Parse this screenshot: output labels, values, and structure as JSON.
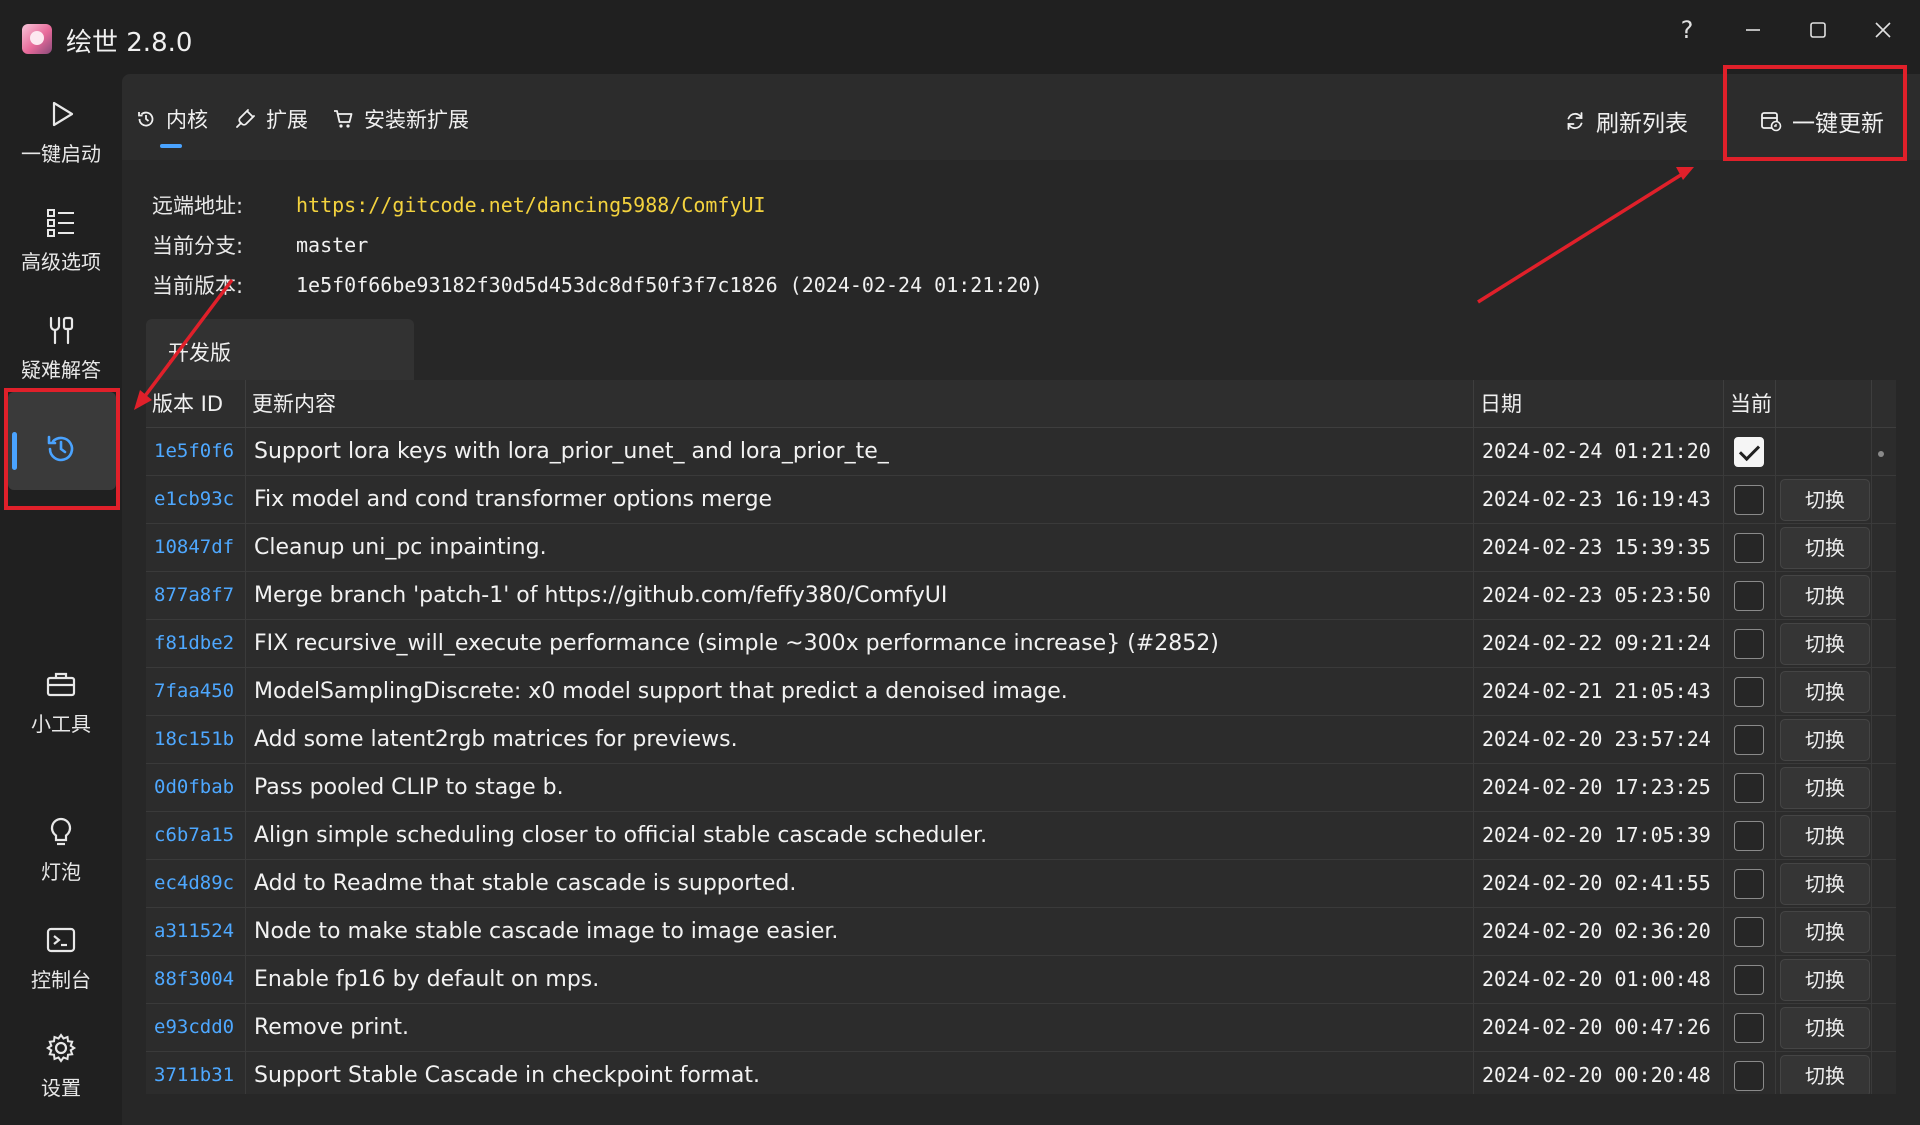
{
  "app": {
    "title": "绘世 2.8.0"
  },
  "window_controls": {
    "help": "?"
  },
  "sidebar": {
    "items": [
      {
        "label": "一键启动",
        "icon": "play-icon"
      },
      {
        "label": "高级选项",
        "icon": "list-icon"
      },
      {
        "label": "疑难解答",
        "icon": "tools-icon"
      },
      {
        "label": "",
        "icon": "history-icon",
        "active": true
      },
      {
        "label": "小工具",
        "icon": "toolbox-icon"
      },
      {
        "label": "灯泡",
        "icon": "bulb-icon"
      },
      {
        "label": "控制台",
        "icon": "console-icon"
      },
      {
        "label": "设置",
        "icon": "gear-icon"
      }
    ]
  },
  "tabs": [
    {
      "label": "内核",
      "icon": "history-icon",
      "active": true
    },
    {
      "label": "扩展",
      "icon": "plug-icon"
    },
    {
      "label": "安装新扩展",
      "icon": "cart-icon"
    }
  ],
  "toolbar": {
    "refresh_label": "刷新列表",
    "update_label": "一键更新"
  },
  "info": {
    "remote_label": "远端地址:",
    "remote_value": "https://gitcode.net/dancing5988/ComfyUI",
    "branch_label": "当前分支:",
    "branch_value": "master",
    "version_label": "当前版本:",
    "version_value": "1e5f0f66be93182f30d5d453dc8df50f3f7c1826 (2024-02-24 01:21:20)"
  },
  "version_tab": "开发版",
  "table": {
    "headers": {
      "id": "版本 ID",
      "message": "更新内容",
      "date": "日期",
      "current": "当前"
    },
    "switch_label": "切换",
    "rows": [
      {
        "id": "1e5f0f6",
        "message": "Support lora keys with lora_prior_unet_ and lora_prior_te_",
        "date": "2024-02-24 01:21:20",
        "current": true
      },
      {
        "id": "e1cb93c",
        "message": "Fix model and cond transformer options merge",
        "date": "2024-02-23 16:19:43",
        "current": false
      },
      {
        "id": "10847df",
        "message": "Cleanup uni_pc inpainting.",
        "date": "2024-02-23 15:39:35",
        "current": false
      },
      {
        "id": "877a8f7",
        "message": "Merge branch 'patch-1' of https://github.com/feffy380/ComfyUI",
        "date": "2024-02-23 05:23:50",
        "current": false
      },
      {
        "id": "f81dbe2",
        "message": "FIX recursive_will_execute performance (simple ~300x performance increase} (#2852)",
        "date": "2024-02-22 09:21:24",
        "current": false
      },
      {
        "id": "7faa450",
        "message": "ModelSamplingDiscrete: x0 model support that predict a denoised image.",
        "date": "2024-02-21 21:05:43",
        "current": false
      },
      {
        "id": "18c151b",
        "message": "Add some latent2rgb matrices for previews.",
        "date": "2024-02-20 23:57:24",
        "current": false
      },
      {
        "id": "0d0fbab",
        "message": "Pass pooled CLIP to stage b.",
        "date": "2024-02-20 17:23:25",
        "current": false
      },
      {
        "id": "c6b7a15",
        "message": "Align simple scheduling closer to official stable cascade scheduler.",
        "date": "2024-02-20 17:05:39",
        "current": false
      },
      {
        "id": "ec4d89c",
        "message": "Add to Readme that stable cascade is supported.",
        "date": "2024-02-20 02:41:55",
        "current": false
      },
      {
        "id": "a311524",
        "message": "Node to make stable cascade image to image easier.",
        "date": "2024-02-20 02:36:20",
        "current": false
      },
      {
        "id": "88f3004",
        "message": "Enable fp16 by default on mps.",
        "date": "2024-02-20 01:00:48",
        "current": false
      },
      {
        "id": "e93cdd0",
        "message": "Remove print.",
        "date": "2024-02-20 00:47:26",
        "current": false
      },
      {
        "id": "3711b31",
        "message": "Support Stable Cascade in checkpoint format.",
        "date": "2024-02-20 00:20:48",
        "current": false
      }
    ]
  },
  "colors": {
    "accent": "#4aa3ff",
    "url": "#f3d23e",
    "annotation": "#e0202a"
  }
}
